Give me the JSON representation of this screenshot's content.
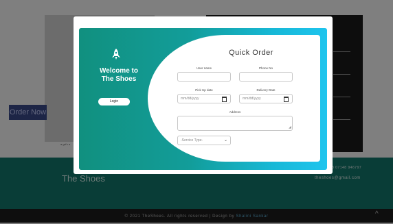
{
  "background": {
    "order_now_label": "Order Now",
    "small_caption": "a grt's a",
    "brand_name": "The Shoes",
    "phone": "8 07148 946797",
    "email": "theshoes@gmail.com",
    "copyright_text": "© 2021 TheShoes. All rights reserved | Design by",
    "designer_name": "Shalini Sankar",
    "scroll_up_icon": "chevron-up-icon"
  },
  "modal": {
    "welcome_line1": "Welcome to",
    "welcome_line2": "The Shoes",
    "login_label": "Login",
    "rocket_icon": "rocket-icon",
    "form_title": "Quick Order",
    "fields": {
      "user_name_label": "User name",
      "user_name_value": "",
      "phone_label": "Phone No",
      "phone_value": "",
      "pickup_label": "Pick Up date",
      "pickup_placeholder": "mm/dd/yyyy",
      "delivery_label": "Delivery Date",
      "delivery_placeholder": "mm/dd/yyyy",
      "address_label": "Address",
      "address_value": "",
      "service_type_selected": "-Service Type-"
    }
  },
  "colors": {
    "teal_dark": "#11907f",
    "cyan_light": "#1ec4ee",
    "footer_teal": "#127a6e",
    "order_now_bg": "#3b4a8c"
  }
}
